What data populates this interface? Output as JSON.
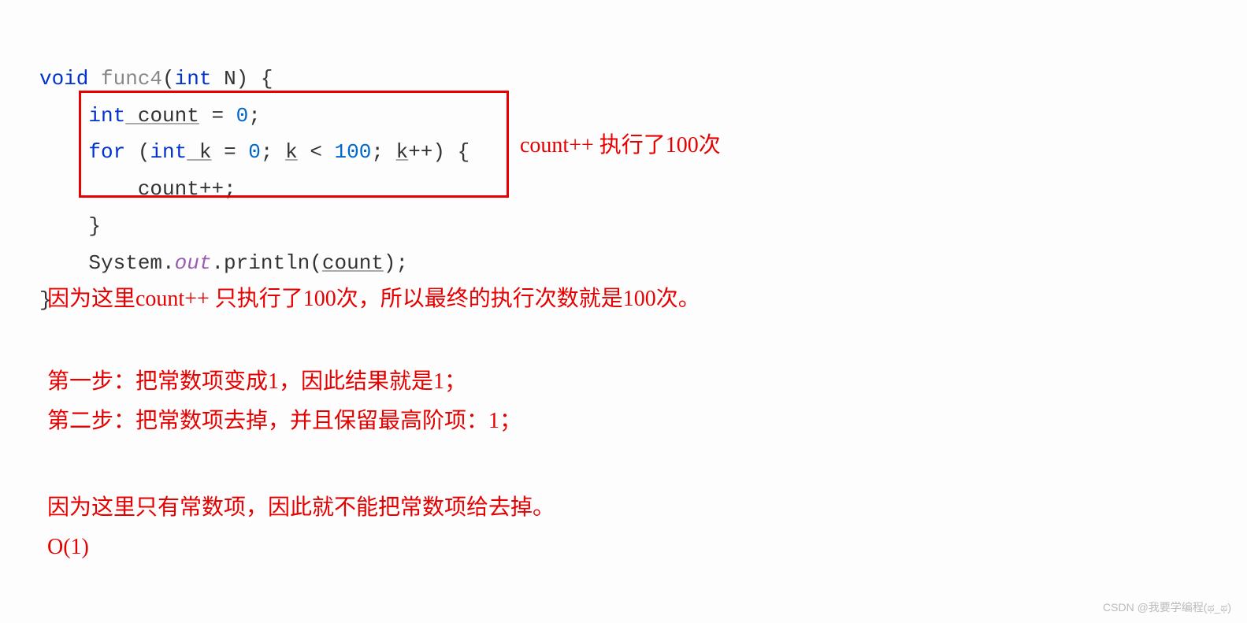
{
  "code": {
    "l1_kw1": "void",
    "l1_fn": " func4",
    "l1_rest": "(",
    "l1_kw2": "int",
    "l1_rest2": " N) {",
    "l2_indent": "    ",
    "l2_kw": "int",
    "l2_var": " count",
    "l2_rest": " = ",
    "l2_num": "0",
    "l2_semi": ";",
    "l3_indent": "    ",
    "l3_kw1": "for",
    "l3_rest1": " (",
    "l3_kw2": "int",
    "l3_var1": " k",
    "l3_rest2": " = ",
    "l3_num1": "0",
    "l3_rest3": "; ",
    "l3_var2": "k",
    "l3_rest4": " < ",
    "l3_num2": "100",
    "l3_rest5": "; ",
    "l3_var3": "k",
    "l3_rest6": "++) {",
    "l4_indent": "        ",
    "l4_var": "count",
    "l4_rest": "++;",
    "l5_indent": "    ",
    "l5_brace": "}",
    "l6_indent": "    ",
    "l6_cls": "System.",
    "l6_field": "out",
    "l6_rest1": ".println(",
    "l6_var": "count",
    "l6_rest2": ");",
    "l7_brace": "}"
  },
  "ann": {
    "right1": "count++ 执行了100次",
    "p1": "因为这里count++ 只执行了100次，所以最终的执行次数就是100次。",
    "p2": "第一步：把常数项变成1，因此结果就是1；",
    "p3": "第二步：把常数项去掉，并且保留最高阶项：1；",
    "p4": "因为这里只有常数项，因此就不能把常数项给去掉。",
    "p5": "O(1)"
  },
  "watermark": "CSDN @我要学编程(ಥ_ಥ)"
}
